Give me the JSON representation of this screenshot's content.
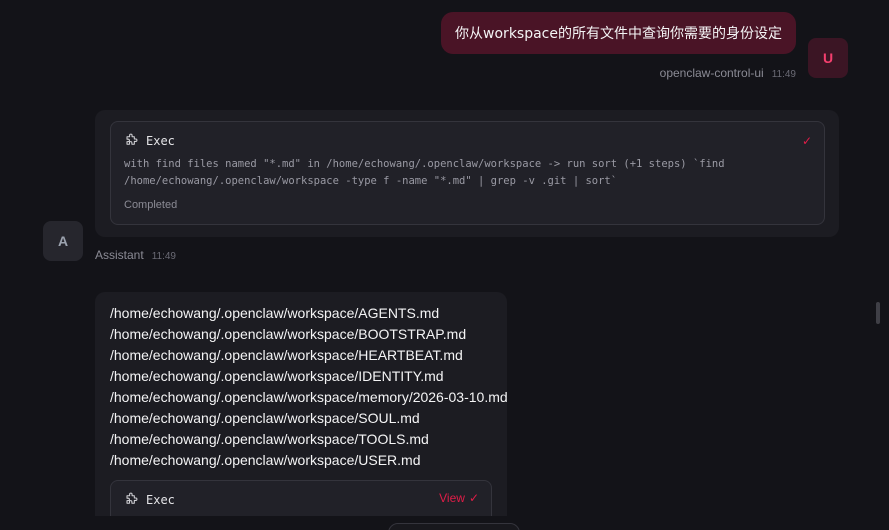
{
  "user_message": {
    "text": "你从workspace的所有文件中查询你需要的身份设定",
    "sender": "openclaw-control-ui",
    "time": "11:49",
    "avatar": "U"
  },
  "assistant": {
    "avatar": "A",
    "name": "Assistant",
    "time": "11:49",
    "tool_call": {
      "title": "Exec",
      "icon": "puzzle-icon",
      "status_icon": "check-icon",
      "detail_line1": "with find files named \"*.md\" in /home/echowang/.openclaw/workspace -> run sort (+1 steps) `find",
      "detail_line2": "/home/echowang/.openclaw/workspace -type f -name \"*.md\" | grep -v .git | sort`",
      "status": "Completed"
    },
    "files": [
      "/home/echowang/.openclaw/workspace/AGENTS.md",
      "/home/echowang/.openclaw/workspace/BOOTSTRAP.md",
      "/home/echowang/.openclaw/workspace/HEARTBEAT.md",
      "/home/echowang/.openclaw/workspace/IDENTITY.md",
      "/home/echowang/.openclaw/workspace/memory/2026-03-10.md",
      "/home/echowang/.openclaw/workspace/SOUL.md",
      "/home/echowang/.openclaw/workspace/TOOLS.md",
      "/home/echowang/.openclaw/workspace/USER.md"
    ],
    "tool_call_2": {
      "title": "Exec",
      "view_label": "View"
    }
  },
  "colors": {
    "accent": "#e11d48",
    "user_bubble": "#4a1426",
    "background": "#131318"
  }
}
